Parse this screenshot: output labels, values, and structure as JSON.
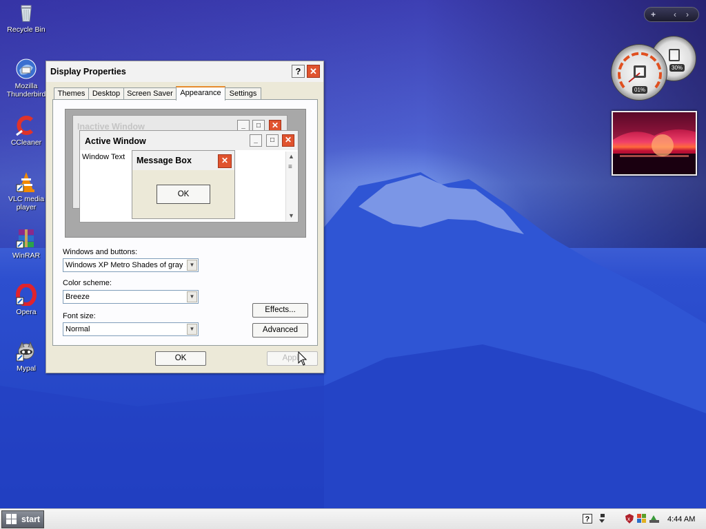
{
  "desktop_icons": [
    {
      "label": "Recycle Bin",
      "icon": "recycle-bin-icon"
    },
    {
      "label": "Mozilla Thunderbird",
      "icon": "thunderbird-icon"
    },
    {
      "label": "CCleaner",
      "icon": "ccleaner-icon"
    },
    {
      "label": "VLC media player",
      "icon": "vlc-icon"
    },
    {
      "label": "WinRAR",
      "icon": "winrar-icon"
    },
    {
      "label": "Opera",
      "icon": "opera-icon"
    },
    {
      "label": "Mypal",
      "icon": "mypal-icon"
    }
  ],
  "gadgets": {
    "cpu_meter": {
      "cpu_percent": "01%",
      "memory_percent": "30%"
    },
    "sidebar_controls": [
      "+",
      "‹",
      "›"
    ]
  },
  "dialog": {
    "title": "Display Properties",
    "help_glyph": "?",
    "close_glyph": "✕",
    "tabs": [
      {
        "label": "Themes",
        "active": false
      },
      {
        "label": "Desktop",
        "active": false
      },
      {
        "label": "Screen Saver",
        "active": false
      },
      {
        "label": "Appearance",
        "active": true
      },
      {
        "label": "Settings",
        "active": false
      }
    ],
    "preview": {
      "inactive_window_title": "Inactive Window",
      "active_window_title": "Active Window",
      "window_text": "Window Text",
      "message_box_title": "Message Box",
      "message_box_ok": "OK"
    },
    "windows_and_buttons": {
      "label": "Windows and buttons:",
      "value": "Windows XP Metro Shades of gray s"
    },
    "color_scheme": {
      "label": "Color scheme:",
      "value": "Breeze"
    },
    "font_size": {
      "label": "Font size:",
      "value": "Normal"
    },
    "effects_button": "Effects...",
    "advanced_button": "Advanced",
    "ok_button": "OK",
    "apply_button": "Apply"
  },
  "taskbar": {
    "start_label": "start",
    "clock": "4:44 AM"
  },
  "colors": {
    "accent_tab": "#e68b2c",
    "close_red": "#e0532e",
    "desktop_blue": "#2a46c8"
  }
}
